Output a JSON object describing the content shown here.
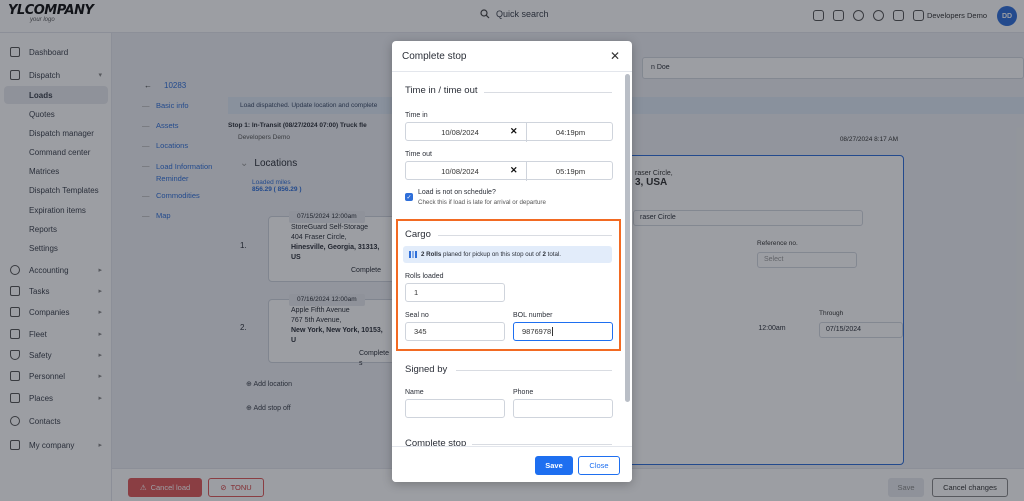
{
  "app": {
    "logo_main": "YLCOMPANY",
    "logo_sub": "your logo",
    "search_label": "Quick search",
    "user_name": "Developers Demo",
    "user_initials": "DD"
  },
  "sidebar": {
    "items": [
      {
        "label": "Dashboard"
      },
      {
        "label": "Dispatch"
      },
      {
        "label": "Loads"
      },
      {
        "label": "Quotes"
      },
      {
        "label": "Dispatch manager"
      },
      {
        "label": "Command center"
      },
      {
        "label": "Matrices"
      },
      {
        "label": "Dispatch Templates"
      },
      {
        "label": "Expiration items"
      },
      {
        "label": "Reports"
      },
      {
        "label": "Settings"
      },
      {
        "label": "Accounting"
      },
      {
        "label": "Tasks"
      },
      {
        "label": "Companies"
      },
      {
        "label": "Fleet"
      },
      {
        "label": "Safety"
      },
      {
        "label": "Personnel"
      },
      {
        "label": "Places"
      },
      {
        "label": "Contacts"
      },
      {
        "label": "My company"
      }
    ]
  },
  "background": {
    "load_id": "10283",
    "nav": [
      "Basic info",
      "Assets",
      "Locations",
      "Load Information Reminder",
      "Commodities",
      "Map"
    ],
    "info_bar": "Load dispatched. Update location and complete",
    "stop_line": "Stop 1: In-Transit (08/27/2024 07:00)  Truck fle",
    "stop_sub": "Developers Demo",
    "locations_title": "Locations",
    "loaded_miles_label": "Loaded miles",
    "loaded_miles_value": "856.29  ( 856.29 )",
    "date_tag": "08/27/2024 8:17 AM",
    "name_field": "n Doe",
    "stops": [
      {
        "num": "1.",
        "date": "07/15/2024  12:00am",
        "name": "StoreGuard Self-Storage",
        "addr1": "404 Fraser Circle,",
        "addr2": "Hinesville, Georgia, 31313, US",
        "action": "Complete"
      },
      {
        "num": "2.",
        "date": "07/16/2024  12:00am",
        "name": "Apple Fifth Avenue",
        "addr1": "767 5th Avenue,",
        "addr2": "New York, New York, 10153, U",
        "action": "Complete s"
      }
    ],
    "add_location": "Add location",
    "add_stop_off": "Add stop off",
    "panel_title_small": "raser Circle,",
    "panel_title_big": "3, USA",
    "panel_select": "raser Circle",
    "reference_label": "Reference no.",
    "reference_placeholder": "Select",
    "through_label": "Through",
    "time_a": "12:00am",
    "date_b": "07/15/2024",
    "time_b": "12:00am"
  },
  "bottom": {
    "cancel_load": "Cancel load",
    "tonu": "TONU",
    "save": "Save",
    "cancel_changes": "Cancel changes"
  },
  "modal": {
    "title": "Complete stop",
    "time_section": "Time in / time out",
    "time_in_label": "Time in",
    "time_in_date": "10/08/2024",
    "time_in_time": "04:19pm",
    "time_out_label": "Time out",
    "time_out_date": "10/08/2024",
    "time_out_time": "05:19pm",
    "schedule_label": "Load is not on schedule?",
    "schedule_hint": "Check this if load is late for arrival or departure",
    "cargo_section": "Cargo",
    "rolls_banner_bold": "2 Rolls",
    "rolls_banner_text": " planed for pickup on this stop out of ",
    "rolls_banner_total": "2",
    "rolls_banner_end": " total.",
    "rolls_loaded_label": "Rolls loaded",
    "rolls_loaded_value": "1",
    "seal_label": "Seal no",
    "seal_value": "345",
    "bol_label": "BOL number",
    "bol_value": "9876978",
    "signed_section": "Signed by",
    "name_label": "Name",
    "phone_label": "Phone",
    "complete_section": "Complete stop",
    "save_label": "Save",
    "close_label": "Close"
  },
  "colors": {
    "accent": "#1e6ff0",
    "highlight": "#f26a22",
    "danger": "#e05a5a"
  }
}
